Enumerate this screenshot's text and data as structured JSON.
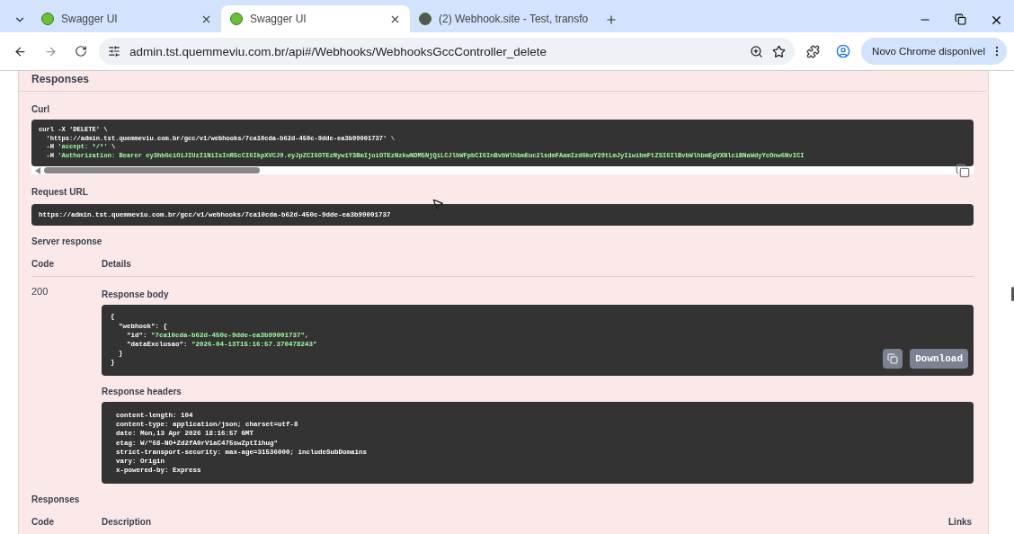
{
  "browser": {
    "tabs": [
      {
        "title": "Swagger UI",
        "selected": false
      },
      {
        "title": "Swagger UI",
        "selected": true
      },
      {
        "title": "(2) Webhook.site - Test, transfo",
        "selected": false
      }
    ],
    "url": "admin.tst.quemmeviu.com.br/api#/Webhooks/WebhooksGccController_delete",
    "update_button": "Novo Chrome disponível"
  },
  "page": {
    "cut_heading": "Responses",
    "curl_label": "Curl",
    "curl_lines": [
      "curl -X 'DELETE' \\",
      "  'https://admin.tst.quemmeviu.com.br/gcc/v1/webhooks/7ca10cda-b62d-450c-9dde-ea3b99001737' \\",
      "  -H 'accept: */*' \\",
      "  -H 'Authorization: Bearer ey3hbGciOiJIUzI1NiIsInR5cCI6IkpXVCJ9.eyJpZCI6OTEzNywiY3BmIjoiOTEzNzkwNDM5NjQiLCJlbWFpbCI6InBvbWlhbmEuc2lsdmFAamIzdGkuY29tLmJyIiwibmFtZSI6IlBvbWlhbmEgVXNlciBNaWdyYcOnw6NvICI"
    ],
    "request_url_label": "Request URL",
    "request_url": "https://admin.tst.quemmeviu.com.br/gcc/v1/webhooks/7ca10cda-b62d-450c-9dde-ea3b99001737",
    "server_response_label": "Server response",
    "code_header": "Code",
    "details_header": "Details",
    "status_code": "200",
    "response_body_label": "Response body",
    "response_body_lines": [
      {
        "text": "{",
        "kind": "plain"
      },
      {
        "text": "  \"webhook\": {",
        "kind": "plain"
      },
      {
        "text": "    \"id\": \"7ca10cda-b62d-450c-9dde-ea3b99001737\",",
        "kind": "pair"
      },
      {
        "text": "    \"dataExclusao\": \"2026-04-13T15:16:57.370478243\"",
        "kind": "pair"
      },
      {
        "text": "  }",
        "kind": "plain"
      },
      {
        "text": "}",
        "kind": "plain"
      }
    ],
    "download_button": "Download",
    "response_headers_label": "Response headers",
    "response_headers": [
      "content-length: 104",
      "content-type: application/json; charset=utf-8",
      "date: Mon,13 Apr 2026 18:16:57 GMT",
      "etag: W/\"68-NO+Zd2fA0rV1aC475swZptIihug\"",
      "strict-transport-security: max-age=31536000; includeSubDomains",
      "vary: Origin",
      "x-powered-by: Express"
    ],
    "responses_label": "Responses",
    "footer_code_header": "Code",
    "description_header": "Description",
    "links_header": "Links"
  }
}
